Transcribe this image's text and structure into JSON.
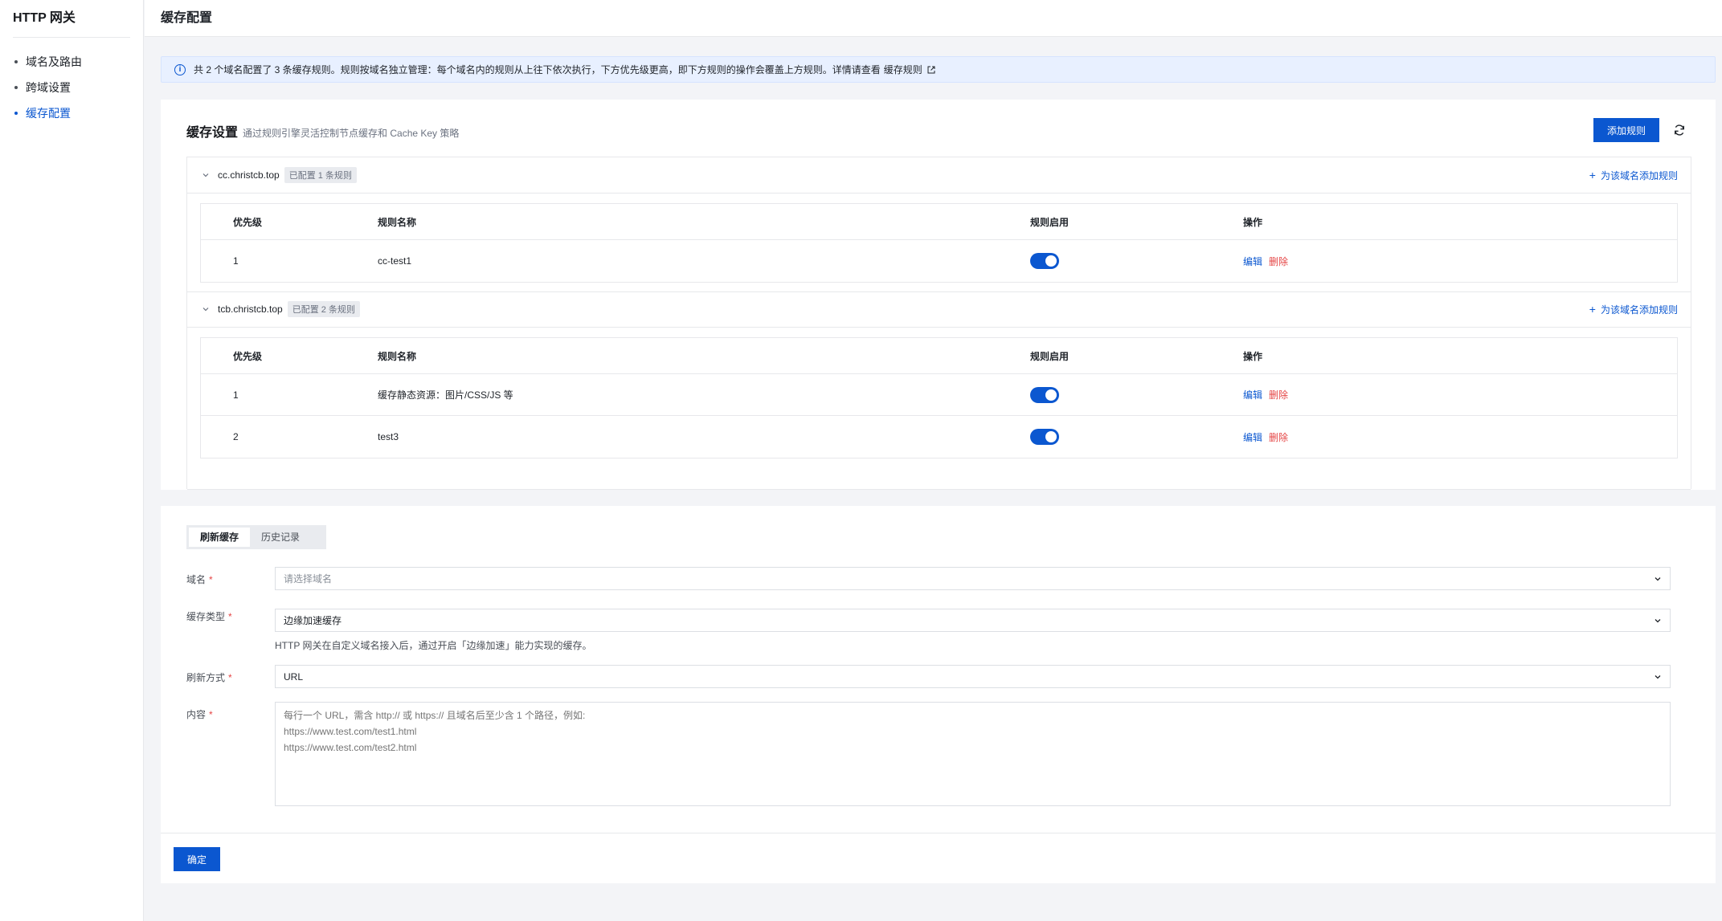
{
  "sidebar": {
    "title": "HTTP 网关",
    "items": [
      {
        "label": "域名及路由",
        "active": false
      },
      {
        "label": "跨域设置",
        "active": false
      },
      {
        "label": "缓存配置",
        "active": true
      }
    ]
  },
  "header": {
    "title": "缓存配置"
  },
  "alert": {
    "text": "共 2 个域名配置了 3 条缓存规则。规则按域名独立管理：每个域名内的规则从上往下依次执行，下方优先级更高，即下方规则的操作会覆盖上方规则。详情请查看",
    "link_label": "缓存规则"
  },
  "cache_settings": {
    "title": "缓存设置",
    "subtitle": "通过规则引擎灵活控制节点缓存和 Cache Key 策略",
    "add_rule_label": "添加规则",
    "columns": [
      "优先级",
      "规则名称",
      "规则启用",
      "操作"
    ],
    "add_domain_rule_label": "为该域名添加规则",
    "edit_label": "编辑",
    "delete_label": "删除",
    "domains": [
      {
        "name": "cc.christcb.top",
        "tag": "已配置 1 条规则",
        "rules": [
          {
            "priority": "1",
            "name": "cc-test1",
            "enabled": true
          }
        ]
      },
      {
        "name": "tcb.christcb.top",
        "tag": "已配置 2 条规则",
        "rules": [
          {
            "priority": "1",
            "name": "缓存静态资源：图片/CSS/JS 等",
            "enabled": true
          },
          {
            "priority": "2",
            "name": "test3",
            "enabled": true
          }
        ]
      }
    ]
  },
  "refresh": {
    "tabs": [
      {
        "label": "刷新缓存",
        "active": true
      },
      {
        "label": "历史记录",
        "active": false
      }
    ],
    "domain_label": "域名",
    "domain_placeholder": "请选择域名",
    "cache_type_label": "缓存类型",
    "cache_type_value": "边缘加速缓存",
    "cache_type_help": "HTTP 网关在自定义域名接入后，通过开启「边缘加速」能力实现的缓存。",
    "method_label": "刷新方式",
    "method_value": "URL",
    "content_label": "内容",
    "content_placeholder": "每行一个 URL，需含 http:// 或 https:// 且域名后至少含 1 个路径，例如:\nhttps://www.test.com/test1.html\nhttps://www.test.com/test2.html",
    "confirm_label": "确定"
  },
  "colors": {
    "primary": "#0b57d0",
    "danger": "#e54545",
    "alert_bg": "#e8f0ff",
    "page_bg": "#f3f4f7"
  }
}
